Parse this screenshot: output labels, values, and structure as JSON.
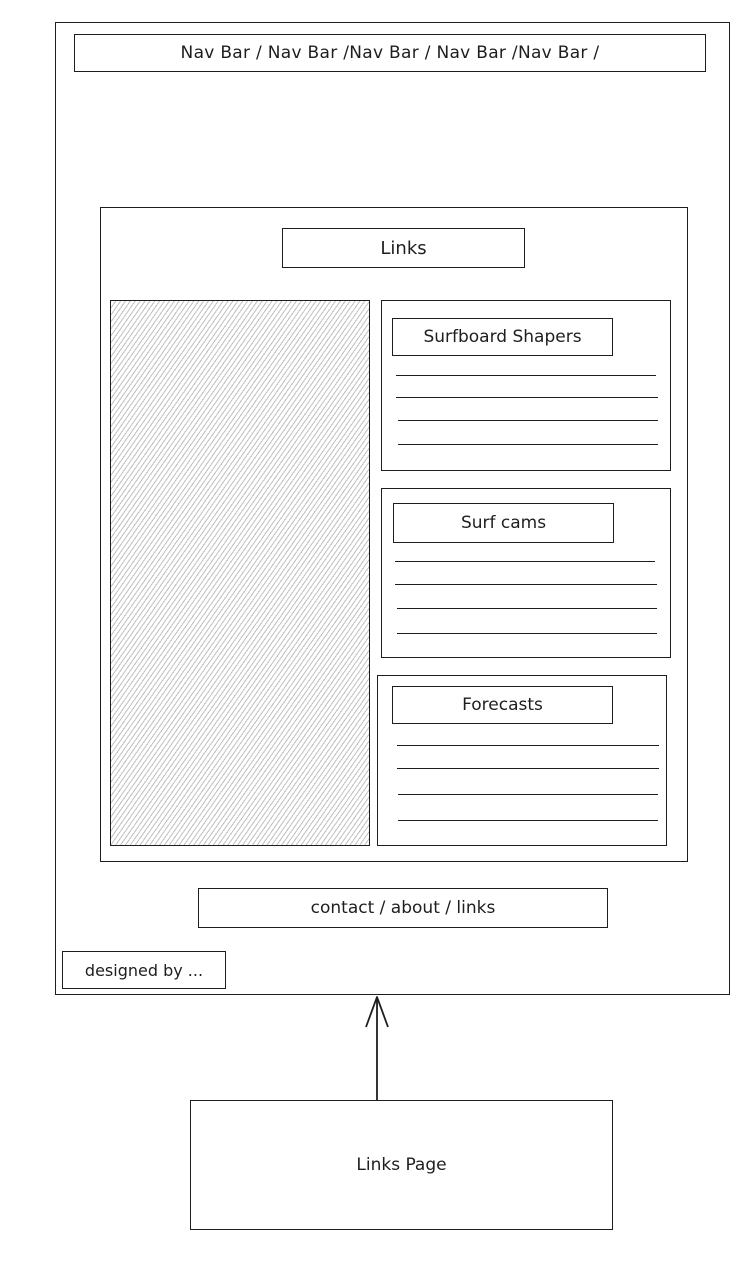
{
  "nav": {
    "text": "Nav Bar / Nav Bar /Nav Bar / Nav Bar /Nav Bar /"
  },
  "content": {
    "heading": "Links",
    "sections": [
      {
        "title": "Surfboard Shapers"
      },
      {
        "title": "Surf cams"
      },
      {
        "title": "Forecasts"
      }
    ]
  },
  "footer": {
    "links": "contact / about / links",
    "credit": "designed by ..."
  },
  "page_label": "Links Page"
}
